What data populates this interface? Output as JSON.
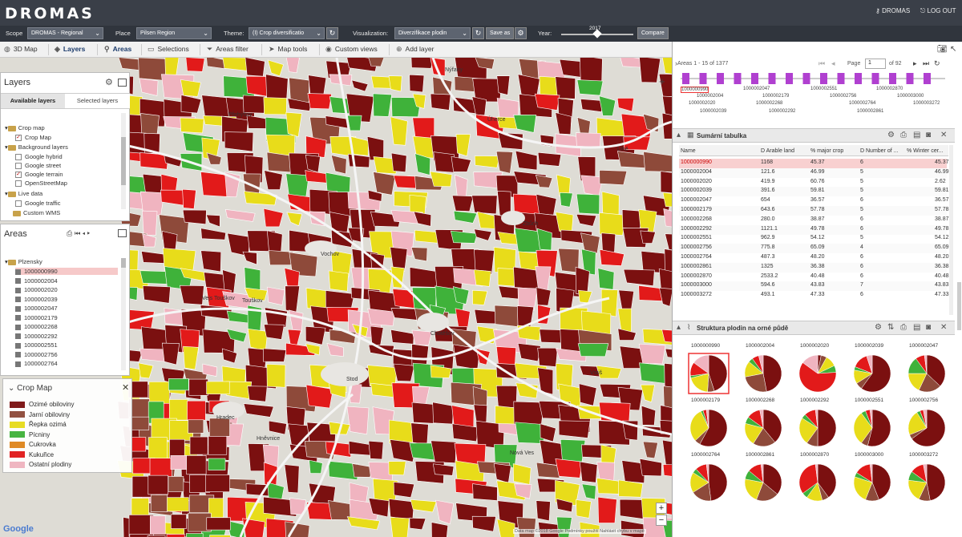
{
  "app": {
    "logo": "DROMAS",
    "user": "DROMAS",
    "logout": "LOG OUT"
  },
  "controls": {
    "scope_label": "Scope",
    "scope_value": "DROMAS - Regional",
    "place_label": "Place",
    "place_value": "Pilsen Region",
    "theme_label": "Theme:",
    "theme_value": "(I) Crop diversificatio",
    "vis_label": "Visualization:",
    "vis_value": "Diverzifikace plodin",
    "save_as": "Save as",
    "year_label": "Year:",
    "year_value": "2017",
    "compare": "Compare"
  },
  "toolbar": {
    "map3d": "3D Map",
    "layers": "Layers",
    "areas": "Areas",
    "selections": "Selections",
    "areas_filter": "Areas filter",
    "map_tools": "Map tools",
    "custom_views": "Custom views",
    "add_layer": "Add layer"
  },
  "layers_panel": {
    "title": "Layers",
    "tab_available": "Available layers",
    "tab_selected": "Selected layers",
    "items": [
      "Crop map",
      "Crop Map",
      "Background layers",
      "Google hybrid",
      "Google street",
      "Google terrain",
      "OpenStreetMap",
      "Live data",
      "Google traffic",
      "Custom WMS"
    ]
  },
  "areas_panel": {
    "title": "Areas",
    "root": "Plzensky",
    "items": [
      "1000000990",
      "1000002004",
      "1000002020",
      "1000002039",
      "1000002047",
      "1000002179",
      "1000002268",
      "1000002292",
      "1000002551",
      "1000002756",
      "1000002764"
    ]
  },
  "legend": {
    "title": "Crop Map",
    "items": [
      {
        "label": "Ozimé obiloviny",
        "color": "#7b1010"
      },
      {
        "label": "Jarní obiloviny",
        "color": "#8e4a3a"
      },
      {
        "label": "Řepka ozimá",
        "color": "#e8dc1a"
      },
      {
        "label": "Pícniny",
        "color": "#3fb23a"
      },
      {
        "label": "Cukrovka",
        "color": "#e0861c"
      },
      {
        "label": "Kukuřice",
        "color": "#e21a1a"
      },
      {
        "label": "Ostatní plodiny",
        "color": "#f0b4c0"
      }
    ]
  },
  "map": {
    "places": [
      "Nýřany",
      "Přehýšov",
      "Úherce",
      "Líně",
      "Zbůch",
      "Vochov",
      "Touškov",
      "Vejs Touškov",
      "Chotěšov",
      "Stod",
      "Hradec",
      "Vstiš",
      "Hněvnice",
      "Nová Ves"
    ],
    "attribution": "Data map ©2018 Google   Podmínky použití   Nahlásit chybu v mapě",
    "google": "Google",
    "colors": {
      "winter": "#7b1010",
      "spring": "#8e4a3a",
      "rape": "#e8dc1a",
      "fodder": "#3fb23a",
      "beet": "#e0861c",
      "maize": "#e21a1a",
      "other": "#f0b4c0"
    }
  },
  "right_panel": {
    "pager": {
      "range": "Areas 1 - 15 of 1377",
      "page_label": "Page",
      "page": "1",
      "of": "of 92"
    },
    "id_rows": [
      [
        "1000000990",
        "1000002047",
        "1000002551",
        "1000002870"
      ],
      [
        "1000002004",
        "1000002179",
        "1000002756",
        "1000003000"
      ],
      [
        "1000002020",
        "1000002268",
        "1000002764",
        "1000003272"
      ],
      [
        "1000002039",
        "1000002292",
        "1000002861"
      ]
    ],
    "table_title": "Sumární tabulka",
    "columns": [
      "Name",
      "D Arable land",
      "% major crop",
      "D Number of ...",
      "% Winter cer..."
    ],
    "rows": [
      [
        "1000000990",
        "1168",
        "45.37",
        "6",
        "45.37"
      ],
      [
        "1000002004",
        "121.6",
        "46.99",
        "5",
        "46.99"
      ],
      [
        "1000002020",
        "419.9",
        "60.76",
        "5",
        "2.62"
      ],
      [
        "1000002039",
        "391.6",
        "59.81",
        "5",
        "59.81"
      ],
      [
        "1000002047",
        "654",
        "36.57",
        "6",
        "36.57"
      ],
      [
        "1000002179",
        "643.6",
        "57.78",
        "5",
        "57.78"
      ],
      [
        "1000002268",
        "280.0",
        "38.87",
        "6",
        "38.87"
      ],
      [
        "1000002292",
        "1121.1",
        "49.78",
        "6",
        "49.78"
      ],
      [
        "1000002551",
        "962.9",
        "54.12",
        "5",
        "54.12"
      ],
      [
        "1000002756",
        "775.8",
        "65.09",
        "4",
        "65.09"
      ],
      [
        "1000002764",
        "487.3",
        "48.20",
        "6",
        "48.20"
      ],
      [
        "1000002861",
        "1325",
        "36.38",
        "6",
        "36.38"
      ],
      [
        "1000002870",
        "2533.2",
        "40.48",
        "6",
        "40.48"
      ],
      [
        "1000003000",
        "594.6",
        "43.83",
        "7",
        "43.83"
      ],
      [
        "1000003272",
        "493.1",
        "47.33",
        "6",
        "47.33"
      ]
    ],
    "chart_title": "Struktura plodin na orné půdě",
    "pies": [
      {
        "name": "1000000990",
        "slices": [
          0.45,
          0.06,
          0.2,
          0.02,
          0.0,
          0.12,
          0.15
        ]
      },
      {
        "name": "1000002004",
        "slices": [
          0.47,
          0.25,
          0.14,
          0.04,
          0.0,
          0.06,
          0.04
        ]
      },
      {
        "name": "1000002020",
        "slices": [
          0.03,
          0.05,
          0.1,
          0.06,
          0.0,
          0.61,
          0.15
        ]
      },
      {
        "name": "1000002039",
        "slices": [
          0.6,
          0.06,
          0.12,
          0.03,
          0.0,
          0.14,
          0.05
        ]
      },
      {
        "name": "1000002047",
        "slices": [
          0.37,
          0.2,
          0.18,
          0.15,
          0.0,
          0.08,
          0.02
        ]
      },
      {
        "name": "1000002179",
        "slices": [
          0.58,
          0.05,
          0.3,
          0.02,
          0.0,
          0.03,
          0.02
        ]
      },
      {
        "name": "1000002268",
        "slices": [
          0.39,
          0.2,
          0.2,
          0.06,
          0.0,
          0.12,
          0.03
        ]
      },
      {
        "name": "1000002292",
        "slices": [
          0.5,
          0.1,
          0.24,
          0.04,
          0.0,
          0.1,
          0.02
        ]
      },
      {
        "name": "1000002551",
        "slices": [
          0.54,
          0.06,
          0.3,
          0.04,
          0.0,
          0.04,
          0.02
        ]
      },
      {
        "name": "1000002756",
        "slices": [
          0.65,
          0.04,
          0.22,
          0.03,
          0.0,
          0.03,
          0.03
        ]
      },
      {
        "name": "1000002764",
        "slices": [
          0.48,
          0.18,
          0.18,
          0.04,
          0.0,
          0.1,
          0.02
        ]
      },
      {
        "name": "1000002861",
        "slices": [
          0.36,
          0.2,
          0.22,
          0.08,
          0.0,
          0.12,
          0.02
        ]
      },
      {
        "name": "1000002870",
        "slices": [
          0.4,
          0.06,
          0.14,
          0.05,
          0.0,
          0.33,
          0.02
        ]
      },
      {
        "name": "1000003000",
        "slices": [
          0.44,
          0.12,
          0.24,
          0.04,
          0.0,
          0.14,
          0.02
        ]
      },
      {
        "name": "1000003272",
        "slices": [
          0.47,
          0.1,
          0.2,
          0.08,
          0.0,
          0.12,
          0.03
        ]
      }
    ]
  }
}
